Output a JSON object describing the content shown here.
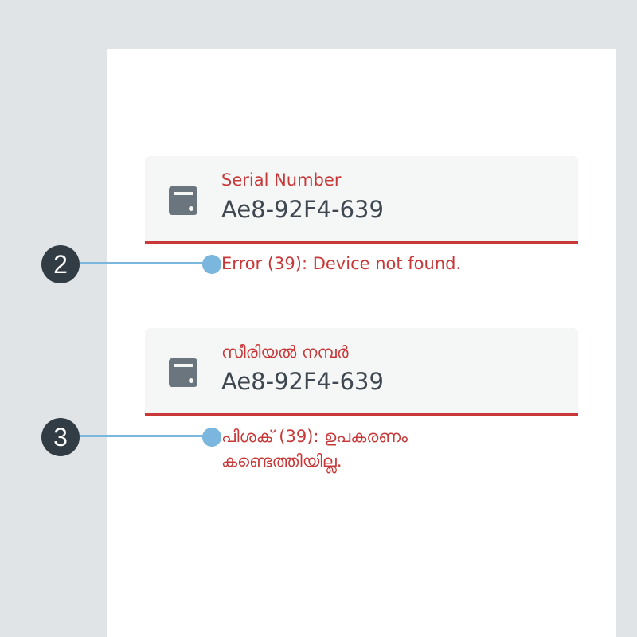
{
  "fields": [
    {
      "label": "Serial Number",
      "value": "Ae8-92F4-639",
      "error": "Error (39): Device not found.",
      "icon": "device-icon",
      "callout": "2"
    },
    {
      "label": "സീരിയൽ നമ്പർ",
      "value": "Ae8-92F4-639",
      "error": "പിശക് (39): ഉപകരണം കണ്ടെത്തിയില്ല.",
      "icon": "device-icon",
      "callout": "3"
    }
  ],
  "colors": {
    "background": "#e1e4e6",
    "card": "#ffffff",
    "field_background": "#f5f6f6",
    "error": "#c83838",
    "value_text": "#3f4850",
    "icon": "#6b757d",
    "callout_line": "#7ab6dd",
    "callout_badge": "#323c44"
  }
}
